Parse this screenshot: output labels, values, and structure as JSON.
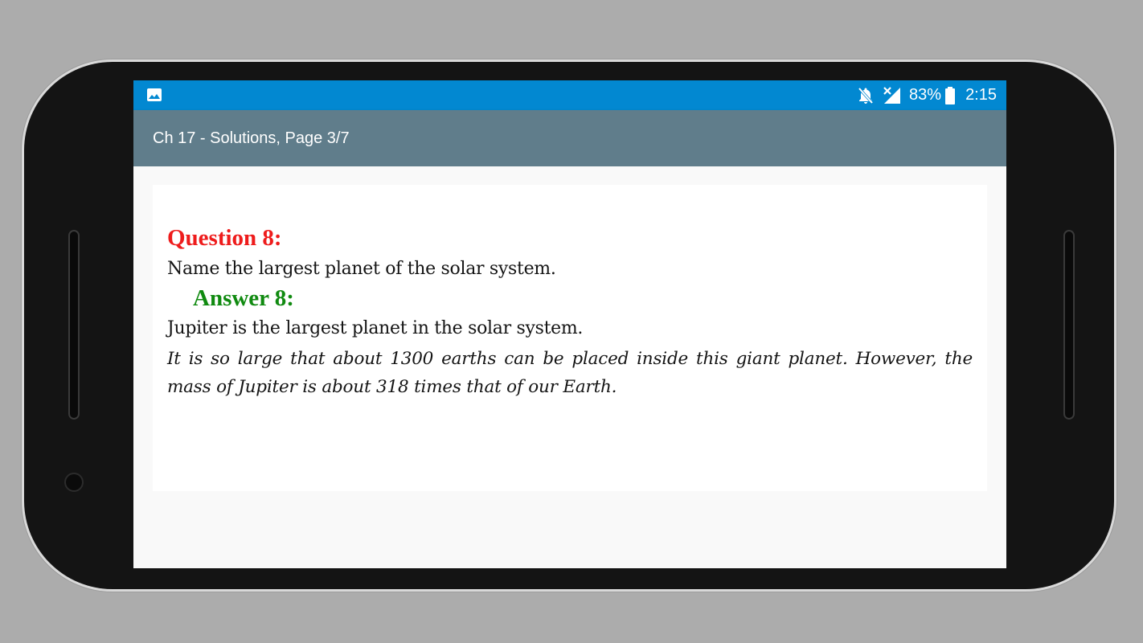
{
  "status_bar": {
    "battery": "83%",
    "time": "2:15",
    "icons": [
      "image-icon",
      "notifications-off-icon",
      "no-signal-icon",
      "battery-icon"
    ]
  },
  "app_bar": {
    "title": "Ch 17 - Solutions, Page 3/7"
  },
  "page": {
    "question_title": "Question 8:",
    "question_text": "Name the largest planet of the solar system.",
    "answer_title": "Answer 8:",
    "answer_text": "Jupiter is the largest planet in the solar system.",
    "answer_detail": "It is so large that about 1300 earths can be placed inside this giant planet. However, the mass of Jupiter is about 318 times that of our Earth."
  },
  "colors": {
    "status_bar": "#0288d1",
    "app_bar": "#607d8b",
    "question": "#ee1c1c",
    "answer": "#108a10"
  }
}
